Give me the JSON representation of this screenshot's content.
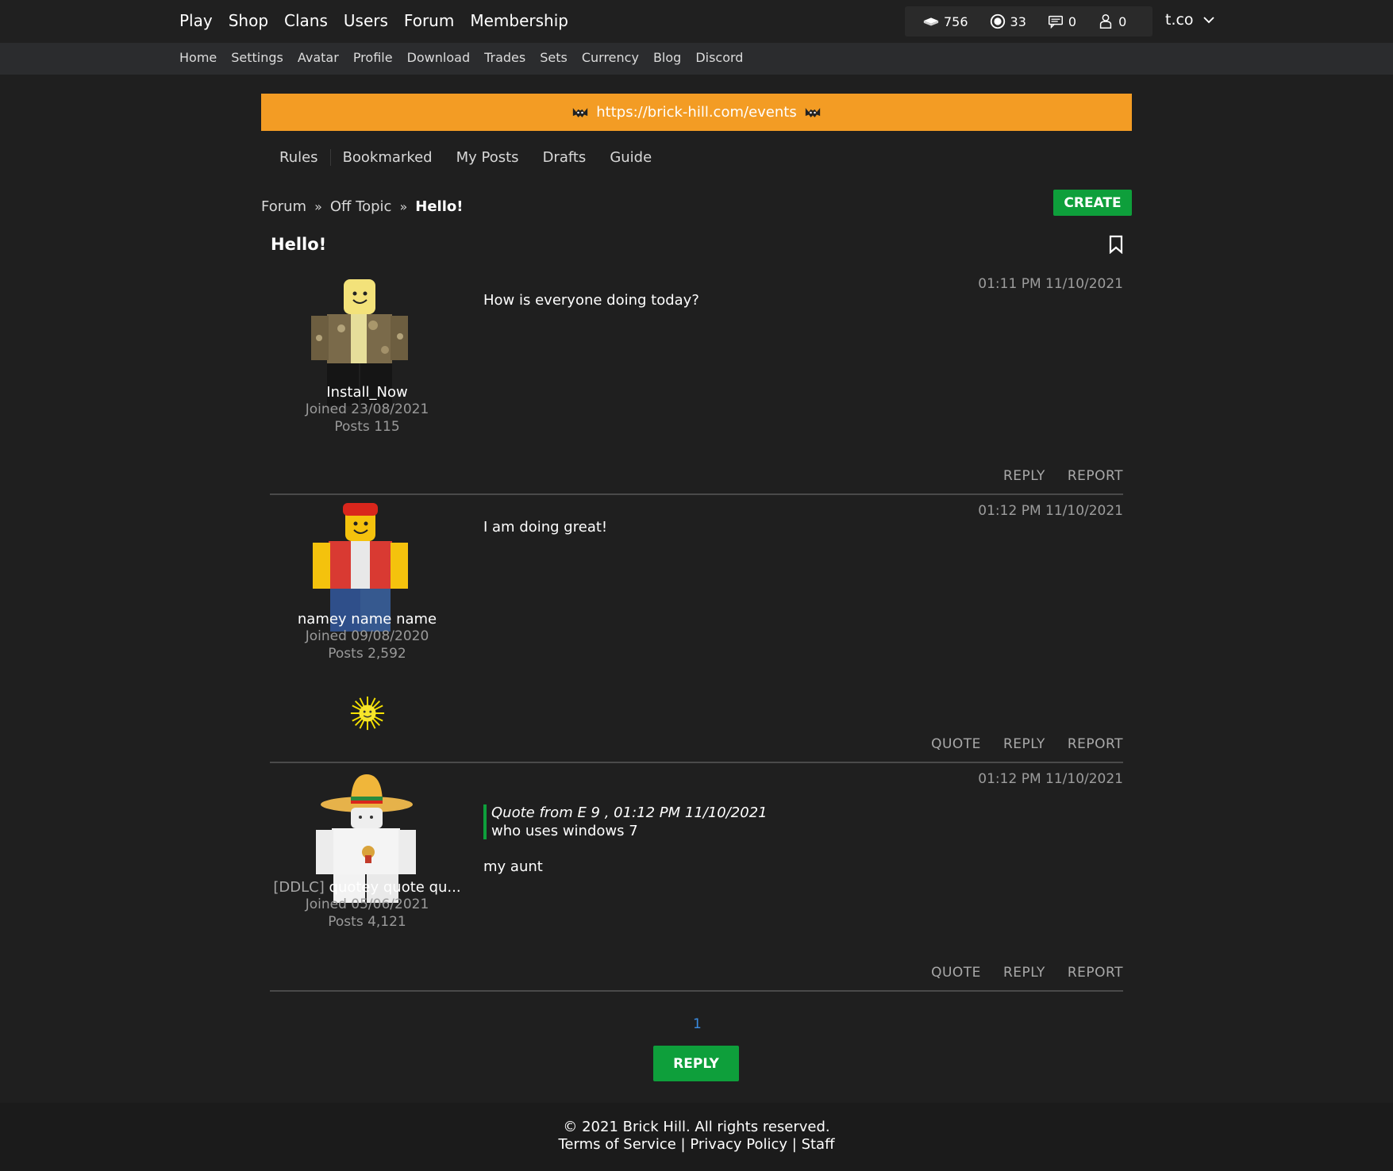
{
  "nav": {
    "main": [
      "Play",
      "Shop",
      "Clans",
      "Users",
      "Forum",
      "Membership"
    ],
    "sub": [
      "Home",
      "Settings",
      "Avatar",
      "Profile",
      "Download",
      "Trades",
      "Sets",
      "Currency",
      "Blog",
      "Discord"
    ]
  },
  "stats": {
    "bucks": "756",
    "bits": "33",
    "messages": "0",
    "friends": "0"
  },
  "user": {
    "name": "t.co"
  },
  "banner": {
    "text": "https://brick-hill.com/events",
    "color": "#f39c24"
  },
  "forum_tabs": [
    "Rules",
    "Bookmarked",
    "My Posts",
    "Drafts",
    "Guide"
  ],
  "breadcrumb": {
    "root": "Forum",
    "category": "Off Topic",
    "current": "Hello!"
  },
  "create_label": "CREATE",
  "thread": {
    "title": "Hello!"
  },
  "posts": [
    {
      "username": "Install_Now",
      "tag": "",
      "joined": "Joined 23/08/2021",
      "posts": "Posts 115",
      "time": "01:11 PM 11/10/2021",
      "body": "How is everyone doing today?",
      "actions": [
        "REPLY",
        "REPORT"
      ]
    },
    {
      "username": "namey name name",
      "tag": "",
      "joined": "Joined 09/08/2020",
      "posts": "Posts 2,592",
      "time": "01:12 PM 11/10/2021",
      "body": "I am doing great!",
      "actions": [
        "QUOTE",
        "REPLY",
        "REPORT"
      ]
    },
    {
      "username": "quotey quote qu...",
      "tag": "[DDLC]",
      "joined": "Joined 05/06/2021",
      "posts": "Posts 4,121",
      "time": "01:12 PM 11/10/2021",
      "quote_header": "Quote from E 9 , 01:12 PM 11/10/2021",
      "quote_text": "who uses windows 7",
      "body": "my aunt",
      "actions": [
        "QUOTE",
        "REPLY",
        "REPORT"
      ]
    }
  ],
  "pagination": {
    "current": "1"
  },
  "reply_label": "REPLY",
  "footer": {
    "copyright": "© 2021 Brick Hill. All rights reserved.",
    "links": [
      "Terms of Service",
      "Privacy Policy",
      "Staff"
    ],
    "separator": "|"
  },
  "colors": {
    "accent_green": "#0e9f3b",
    "banner_orange": "#f39c24",
    "background": "#1f1f1f"
  }
}
